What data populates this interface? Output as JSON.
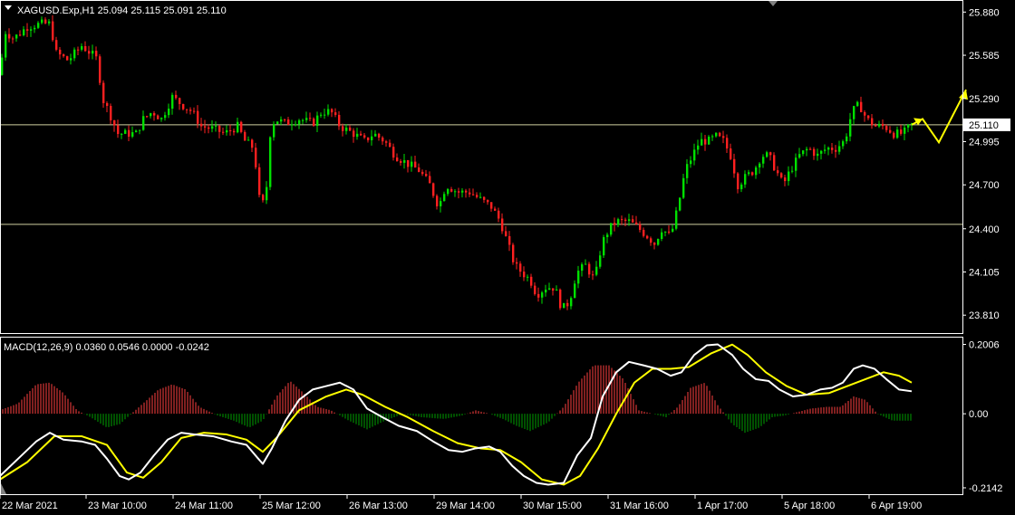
{
  "price_panel": {
    "header": "XAGUSD.Exp,H1  25.094 25.115 25.091 25.110",
    "y_ticks": [
      "25.880",
      "25.585",
      "25.290",
      "24.995",
      "24.700",
      "24.400",
      "24.105",
      "23.810"
    ],
    "price_box": "25.110",
    "colors": {
      "bull": "#00e000",
      "bear": "#ff2020",
      "level": "#d0d0a0",
      "arrow": "#ffff00",
      "axis": "#ffffff",
      "bg": "#000000"
    }
  },
  "macd_panel": {
    "header": "MACD(12,26,9) 0.0360 0.0546 0.0000 -0.0242",
    "y_ticks": [
      "0.2006",
      "0.00",
      "-0.2142"
    ],
    "colors": {
      "main": "#ffffff",
      "signal": "#ffff00",
      "hist_pos": "#ff4040",
      "hist_neg": "#00a000"
    }
  },
  "x_labels": [
    "22 Mar 2021",
    "23 Mar 10:00",
    "24 Mar 11:00",
    "25 Mar 12:00",
    "26 Mar 13:00",
    "29 Mar 14:00",
    "30 Mar 15:00",
    "31 Mar 16:00",
    "1 Apr 17:00",
    "5 Apr 18:00",
    "6 Apr 19:00"
  ],
  "chart_data": {
    "type": "candlestick",
    "symbol": "XAGUSD.Exp",
    "timeframe": "H1",
    "price_ylim": [
      23.7,
      25.95
    ],
    "horizontal_levels": [
      25.11,
      24.43
    ],
    "price_path": [
      [
        0,
        25.45
      ],
      [
        5,
        25.75
      ],
      [
        15,
        25.7
      ],
      [
        30,
        25.78
      ],
      [
        45,
        25.8
      ],
      [
        55,
        25.8
      ],
      [
        62,
        25.6
      ],
      [
        75,
        25.55
      ],
      [
        90,
        25.65
      ],
      [
        100,
        25.6
      ],
      [
        108,
        25.55
      ],
      [
        112,
        25.3
      ],
      [
        120,
        25.2
      ],
      [
        130,
        25.05
      ],
      [
        142,
        25.05
      ],
      [
        150,
        25.05
      ],
      [
        158,
        25.15
      ],
      [
        168,
        25.2
      ],
      [
        178,
        25.15
      ],
      [
        190,
        25.3
      ],
      [
        200,
        25.25
      ],
      [
        212,
        25.2
      ],
      [
        222,
        25.1
      ],
      [
        236,
        25.08
      ],
      [
        248,
        25.05
      ],
      [
        262,
        25.1
      ],
      [
        270,
        25.0
      ],
      [
        280,
        24.95
      ],
      [
        287,
        24.55
      ],
      [
        293,
        24.6
      ],
      [
        298,
        25.05
      ],
      [
        303,
        25.15
      ],
      [
        315,
        25.12
      ],
      [
        330,
        25.15
      ],
      [
        345,
        25.12
      ],
      [
        355,
        25.2
      ],
      [
        365,
        25.2
      ],
      [
        375,
        25.1
      ],
      [
        390,
        25.05
      ],
      [
        402,
        25.0
      ],
      [
        412,
        25.05
      ],
      [
        424,
        25.0
      ],
      [
        436,
        24.9
      ],
      [
        448,
        24.85
      ],
      [
        462,
        24.8
      ],
      [
        474,
        24.7
      ],
      [
        484,
        24.55
      ],
      [
        492,
        24.7
      ],
      [
        505,
        24.65
      ],
      [
        518,
        24.65
      ],
      [
        530,
        24.6
      ],
      [
        542,
        24.55
      ],
      [
        552,
        24.45
      ],
      [
        560,
        24.3
      ],
      [
        568,
        24.15
      ],
      [
        576,
        24.1
      ],
      [
        585,
        24.05
      ],
      [
        592,
        23.95
      ],
      [
        602,
        24.0
      ],
      [
        612,
        24.0
      ],
      [
        620,
        23.85
      ],
      [
        628,
        23.9
      ],
      [
        636,
        24.1
      ],
      [
        646,
        24.15
      ],
      [
        656,
        24.05
      ],
      [
        664,
        24.3
      ],
      [
        672,
        24.4
      ],
      [
        680,
        24.45
      ],
      [
        694,
        24.45
      ],
      [
        705,
        24.4
      ],
      [
        714,
        24.35
      ],
      [
        722,
        24.3
      ],
      [
        730,
        24.4
      ],
      [
        740,
        24.35
      ],
      [
        748,
        24.55
      ],
      [
        756,
        24.8
      ],
      [
        764,
        24.9
      ],
      [
        772,
        25.0
      ],
      [
        782,
        25.0
      ],
      [
        790,
        25.03
      ],
      [
        798,
        25.0
      ],
      [
        806,
        24.9
      ],
      [
        814,
        24.7
      ],
      [
        822,
        24.75
      ],
      [
        832,
        24.8
      ],
      [
        840,
        24.9
      ],
      [
        848,
        24.9
      ],
      [
        856,
        24.8
      ],
      [
        864,
        24.7
      ],
      [
        872,
        24.8
      ],
      [
        882,
        24.9
      ],
      [
        892,
        24.95
      ],
      [
        902,
        24.9
      ],
      [
        912,
        24.95
      ],
      [
        922,
        24.95
      ],
      [
        932,
        25.0
      ],
      [
        940,
        25.2
      ],
      [
        948,
        25.25
      ],
      [
        956,
        25.15
      ],
      [
        966,
        25.1
      ],
      [
        976,
        25.1
      ],
      [
        986,
        25.05
      ],
      [
        996,
        25.05
      ],
      [
        1006,
        25.11
      ]
    ],
    "projection": [
      [
        1006,
        25.11
      ],
      [
        1018,
        25.15
      ],
      [
        1036,
        24.99
      ],
      [
        1066,
        25.35
      ]
    ],
    "macd": {
      "ylim": [
        -0.23,
        0.215
      ],
      "main": [
        [
          0,
          -0.18
        ],
        [
          20,
          -0.13
        ],
        [
          40,
          -0.08
        ],
        [
          55,
          -0.055
        ],
        [
          70,
          -0.075
        ],
        [
          90,
          -0.08
        ],
        [
          105,
          -0.09
        ],
        [
          118,
          -0.13
        ],
        [
          132,
          -0.18
        ],
        [
          142,
          -0.19
        ],
        [
          155,
          -0.17
        ],
        [
          170,
          -0.12
        ],
        [
          185,
          -0.075
        ],
        [
          200,
          -0.055
        ],
        [
          215,
          -0.06
        ],
        [
          235,
          -0.065
        ],
        [
          255,
          -0.08
        ],
        [
          272,
          -0.09
        ],
        [
          285,
          -0.13
        ],
        [
          290,
          -0.145
        ],
        [
          300,
          -0.1
        ],
        [
          315,
          -0.02
        ],
        [
          330,
          0.04
        ],
        [
          345,
          0.07
        ],
        [
          360,
          0.08
        ],
        [
          375,
          0.09
        ],
        [
          390,
          0.07
        ],
        [
          405,
          0.015
        ],
        [
          422,
          -0.01
        ],
        [
          440,
          -0.035
        ],
        [
          460,
          -0.05
        ],
        [
          478,
          -0.08
        ],
        [
          495,
          -0.105
        ],
        [
          510,
          -0.11
        ],
        [
          525,
          -0.1
        ],
        [
          540,
          -0.095
        ],
        [
          552,
          -0.11
        ],
        [
          565,
          -0.15
        ],
        [
          578,
          -0.18
        ],
        [
          592,
          -0.2
        ],
        [
          605,
          -0.205
        ],
        [
          622,
          -0.2
        ],
        [
          637,
          -0.12
        ],
        [
          652,
          -0.07
        ],
        [
          665,
          0.05
        ],
        [
          680,
          0.12
        ],
        [
          694,
          0.15
        ],
        [
          710,
          0.14
        ],
        [
          725,
          0.13
        ],
        [
          740,
          0.11
        ],
        [
          752,
          0.12
        ],
        [
          766,
          0.17
        ],
        [
          780,
          0.198
        ],
        [
          792,
          0.2006
        ],
        [
          808,
          0.17
        ],
        [
          820,
          0.13
        ],
        [
          834,
          0.1
        ],
        [
          848,
          0.095
        ],
        [
          860,
          0.07
        ],
        [
          875,
          0.05
        ],
        [
          890,
          0.055
        ],
        [
          905,
          0.07
        ],
        [
          918,
          0.075
        ],
        [
          930,
          0.09
        ],
        [
          942,
          0.13
        ],
        [
          952,
          0.14
        ],
        [
          965,
          0.13
        ],
        [
          978,
          0.1
        ],
        [
          992,
          0.07
        ],
        [
          1006,
          0.065
        ]
      ],
      "signal": [
        [
          0,
          -0.19
        ],
        [
          30,
          -0.14
        ],
        [
          60,
          -0.065
        ],
        [
          90,
          -0.065
        ],
        [
          118,
          -0.09
        ],
        [
          140,
          -0.17
        ],
        [
          158,
          -0.185
        ],
        [
          178,
          -0.14
        ],
        [
          200,
          -0.07
        ],
        [
          225,
          -0.055
        ],
        [
          250,
          -0.06
        ],
        [
          272,
          -0.075
        ],
        [
          290,
          -0.11
        ],
        [
          305,
          -0.07
        ],
        [
          330,
          0.01
        ],
        [
          360,
          0.05
        ],
        [
          382,
          0.07
        ],
        [
          400,
          0.055
        ],
        [
          425,
          0.02
        ],
        [
          450,
          -0.01
        ],
        [
          478,
          -0.05
        ],
        [
          505,
          -0.085
        ],
        [
          530,
          -0.1
        ],
        [
          552,
          -0.105
        ],
        [
          575,
          -0.14
        ],
        [
          598,
          -0.19
        ],
        [
          622,
          -0.205
        ],
        [
          640,
          -0.18
        ],
        [
          660,
          -0.1
        ],
        [
          680,
          0.0
        ],
        [
          700,
          0.09
        ],
        [
          720,
          0.13
        ],
        [
          740,
          0.13
        ],
        [
          760,
          0.135
        ],
        [
          785,
          0.175
        ],
        [
          808,
          0.2
        ],
        [
          825,
          0.17
        ],
        [
          845,
          0.12
        ],
        [
          868,
          0.08
        ],
        [
          890,
          0.055
        ],
        [
          915,
          0.06
        ],
        [
          935,
          0.08
        ],
        [
          955,
          0.1
        ],
        [
          975,
          0.12
        ],
        [
          992,
          0.11
        ],
        [
          1006,
          0.09
        ]
      ],
      "histogram": [
        [
          0,
          0.01
        ],
        [
          20,
          0.03
        ],
        [
          40,
          0.085
        ],
        [
          55,
          0.09
        ],
        [
          70,
          0.06
        ],
        [
          85,
          0.01
        ],
        [
          100,
          -0.01
        ],
        [
          118,
          -0.04
        ],
        [
          132,
          -0.03
        ],
        [
          145,
          0.0
        ],
        [
          158,
          0.03
        ],
        [
          175,
          0.07
        ],
        [
          190,
          0.085
        ],
        [
          205,
          0.07
        ],
        [
          220,
          0.02
        ],
        [
          240,
          -0.005
        ],
        [
          258,
          -0.02
        ],
        [
          275,
          -0.04
        ],
        [
          290,
          -0.02
        ],
        [
          305,
          0.05
        ],
        [
          320,
          0.095
        ],
        [
          335,
          0.06
        ],
        [
          350,
          0.02
        ],
        [
          365,
          0.01
        ],
        [
          385,
          -0.02
        ],
        [
          405,
          -0.045
        ],
        [
          425,
          -0.02
        ],
        [
          445,
          0.0
        ],
        [
          465,
          -0.01
        ],
        [
          490,
          -0.015
        ],
        [
          510,
          -0.005
        ],
        [
          525,
          0.01
        ],
        [
          540,
          0.0
        ],
        [
          555,
          -0.015
        ],
        [
          570,
          -0.035
        ],
        [
          585,
          -0.05
        ],
        [
          605,
          -0.025
        ],
        [
          622,
          0.02
        ],
        [
          638,
          0.09
        ],
        [
          655,
          0.14
        ],
        [
          672,
          0.14
        ],
        [
          688,
          0.1
        ],
        [
          705,
          0.01
        ],
        [
          720,
          0.0
        ],
        [
          735,
          -0.01
        ],
        [
          748,
          0.02
        ],
        [
          762,
          0.075
        ],
        [
          778,
          0.09
        ],
        [
          792,
          0.025
        ],
        [
          808,
          -0.03
        ],
        [
          822,
          -0.055
        ],
        [
          838,
          -0.04
        ],
        [
          852,
          -0.01
        ],
        [
          866,
          -0.005
        ],
        [
          880,
          0.005
        ],
        [
          895,
          0.015
        ],
        [
          912,
          0.02
        ],
        [
          928,
          0.02
        ],
        [
          942,
          0.05
        ],
        [
          955,
          0.04
        ],
        [
          968,
          0.0
        ],
        [
          985,
          -0.02
        ],
        [
          1006,
          -0.02
        ]
      ]
    }
  }
}
